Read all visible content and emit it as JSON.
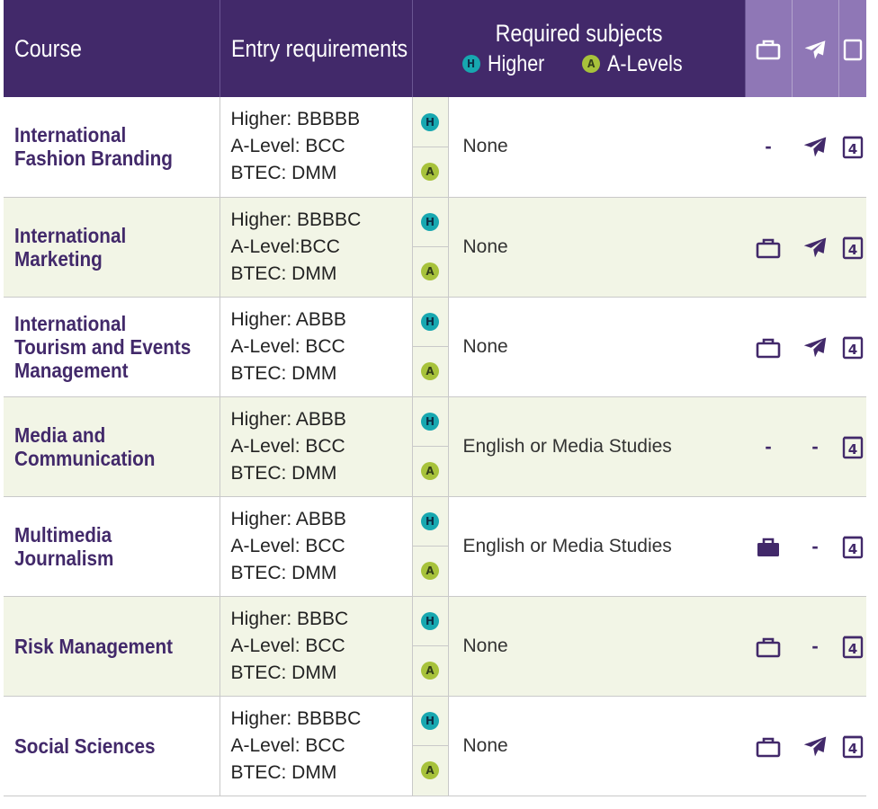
{
  "header": {
    "course": "Course",
    "entry": "Entry requirements",
    "required": "Required subjects",
    "legend_h_badge": "H",
    "legend_h": "Higher",
    "legend_a_badge": "A",
    "legend_a": "A-Levels",
    "icon_work": "briefcase-icon",
    "icon_abroad": "plane-icon",
    "icon_years": "calendar-icon"
  },
  "colors": {
    "header_bg": "#42296a",
    "header_icon_bg": "#8f77b6",
    "course_text": "#42296a",
    "row_shade": "#f2f5e6",
    "higher_badge": "#17a7b0",
    "alevel_badge": "#a7c23b"
  },
  "rows": [
    {
      "course": "International Fashion Branding",
      "entry_higher_label": "Higher:",
      "entry_higher": " BBBBB",
      "entry_alevel_label": "A-Level:",
      "entry_alevel": " BCC",
      "entry_btec_label": "BTEC:",
      "entry_btec": " DMM",
      "badge_h": "H",
      "badge_a": "A",
      "subjects": "None",
      "work": "-",
      "abroad": "plane-icon",
      "years": "4"
    },
    {
      "course": "International Marketing",
      "entry_higher_label": "Higher:",
      "entry_higher": " BBBBC",
      "entry_alevel_label": "A-Level:",
      "entry_alevel": "BCC",
      "entry_btec_label": "BTEC:",
      "entry_btec": " DMM",
      "badge_h": "H",
      "badge_a": "A",
      "subjects": "None",
      "work": "briefcase-outline-icon",
      "abroad": "plane-icon",
      "years": "4"
    },
    {
      "course": "International Tourism and Events Management",
      "entry_higher_label": "Higher:",
      "entry_higher": " ABBB",
      "entry_alevel_label": "A-Level:",
      "entry_alevel": " BCC",
      "entry_btec_label": "BTEC:",
      "entry_btec": " DMM",
      "badge_h": "H",
      "badge_a": "A",
      "subjects": "None",
      "work": "briefcase-outline-icon",
      "abroad": "plane-icon",
      "years": "4"
    },
    {
      "course": "Media and Communication",
      "entry_higher_label": "Higher:",
      "entry_higher": " ABBB",
      "entry_alevel_label": "A-Level:",
      "entry_alevel": " BCC",
      "entry_btec_label": "BTEC:",
      "entry_btec": " DMM",
      "badge_h": "H",
      "badge_a": "A",
      "subjects": "English or Media Studies",
      "work": "-",
      "abroad": "-",
      "years": "4"
    },
    {
      "course": "Multimedia Journalism",
      "entry_higher_label": "Higher:",
      "entry_higher": " ABBB",
      "entry_alevel_label": "A-Level:",
      "entry_alevel": " BCC",
      "entry_btec_label": "BTEC:",
      "entry_btec": " DMM",
      "badge_h": "H",
      "badge_a": "A",
      "subjects": "English or Media Studies",
      "work": "briefcase-filled-icon",
      "abroad": "-",
      "years": "4"
    },
    {
      "course": "Risk Management",
      "entry_higher_label": "Higher:",
      "entry_higher": " BBBC",
      "entry_alevel_label": "A-Level:",
      "entry_alevel": " BCC",
      "entry_btec_label": "BTEC:",
      "entry_btec": " DMM",
      "badge_h": "H",
      "badge_a": "A",
      "subjects": "None",
      "work": "briefcase-outline-icon",
      "abroad": "-",
      "years": "4"
    },
    {
      "course": "Social Sciences",
      "entry_higher_label": "Higher:",
      "entry_higher": " BBBBC",
      "entry_alevel_label": "A-Level:",
      "entry_alevel": " BCC",
      "entry_btec_label": "BTEC:",
      "entry_btec": " DMM",
      "badge_h": "H",
      "badge_a": "A",
      "subjects": "None",
      "work": "briefcase-outline-icon",
      "abroad": "plane-icon",
      "years": "4"
    }
  ]
}
